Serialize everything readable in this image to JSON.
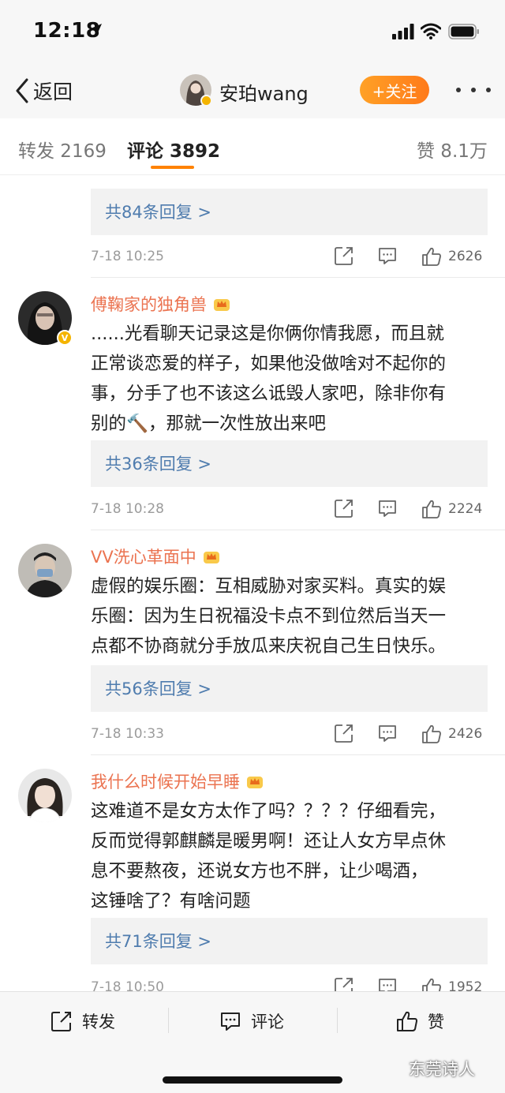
{
  "status_bar": {
    "time": "12:18"
  },
  "nav": {
    "back_label": "返回",
    "user_name": "安珀wang",
    "follow_label": "+关注"
  },
  "tabs": [
    {
      "label": "转发 2169"
    },
    {
      "label": "评论 3892"
    },
    {
      "label": "赞 8.1万"
    }
  ],
  "comments": [
    {
      "replies_label": "共84条回复 >",
      "time": "7-18 10:25",
      "likes": "2626"
    },
    {
      "user": "傅鞠家的独角兽",
      "lines": [
        "......光看聊天记录这是你俩你情我愿，而且就",
        "正常谈恋爱的样子，如果他没做啥对不起你的",
        "事，分手了也不该这么诋毁人家吧，除非你有",
        "别的🔨，那就一次性放出来吧"
      ],
      "replies_label": "共36条回复 >",
      "time": "7-18 10:28",
      "likes": "2224"
    },
    {
      "user": "VV洗心革面中",
      "lines": [
        "虚假的娱乐圈：互相威胁对家买料。真实的娱",
        "乐圈：因为生日祝福没卡点不到位然后当天一",
        "点都不协商就分手放瓜来庆祝自己生日快乐。"
      ],
      "replies_label": "共56条回复 >",
      "time": "7-18 10:33",
      "likes": "2426"
    },
    {
      "user": "我什么时候开始早睡",
      "lines": [
        "这难道不是女方太作了吗？？？？仔细看完，",
        "反而觉得郭麒麟是暖男啊！还让人女方早点休",
        "息不要熬夜，还说女方也不胖，让少喝酒，",
        "这锤啥了？有啥问题"
      ],
      "replies_label": "共71条回复 >",
      "time": "7-18 10:50",
      "likes": "1952"
    }
  ],
  "bottom_bar": {
    "repost": "转发",
    "comment": "评论",
    "like": "赞",
    "watermark": "东莞诗人"
  },
  "colors": {
    "accent": "#ff8200",
    "username": "#eb7350",
    "link": "#4f7cae",
    "verified": "#f4b400"
  },
  "icons": [
    "location-arrow-icon",
    "cellular-signal-icon",
    "wifi-icon",
    "battery-icon",
    "back-chevron-icon",
    "more-icon",
    "share-icon",
    "comment-icon",
    "like-icon",
    "crown-icon",
    "verified-icon"
  ]
}
